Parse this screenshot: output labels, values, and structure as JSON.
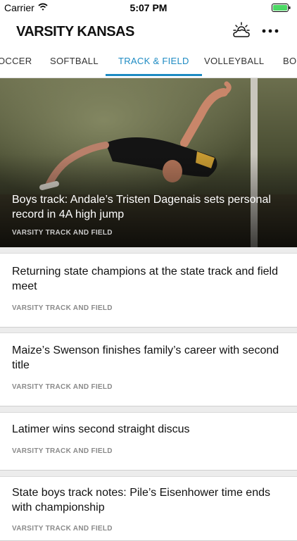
{
  "status_bar": {
    "carrier": "Carrier",
    "time": "5:07 PM"
  },
  "header": {
    "title": "VARSITY KANSAS"
  },
  "tabs": [
    {
      "label": "OCCER"
    },
    {
      "label": "SOFTBALL"
    },
    {
      "label": "TRACK & FIELD"
    },
    {
      "label": "VOLLEYBALL"
    },
    {
      "label": "BO"
    }
  ],
  "active_tab_index": 2,
  "hero": {
    "title": "Boys track: Andale’s Tristen Dagenais sets personal record in 4A high jump",
    "category": "VARSITY TRACK AND FIELD"
  },
  "articles": [
    {
      "title": "Returning state champions at the state track and field meet",
      "category": "VARSITY TRACK AND FIELD"
    },
    {
      "title": "Maize’s Swenson finishes family’s career with second title",
      "category": "VARSITY TRACK AND FIELD"
    },
    {
      "title": "Latimer wins second straight discus",
      "category": "VARSITY TRACK AND FIELD"
    },
    {
      "title": "State boys track notes: Pile’s Eisenhower time ends with championship",
      "category": "VARSITY TRACK AND FIELD"
    }
  ],
  "colors": {
    "accent": "#1e8bc3"
  },
  "icons": [
    "wifi-icon",
    "battery-icon",
    "weather-icon",
    "more-icon"
  ]
}
